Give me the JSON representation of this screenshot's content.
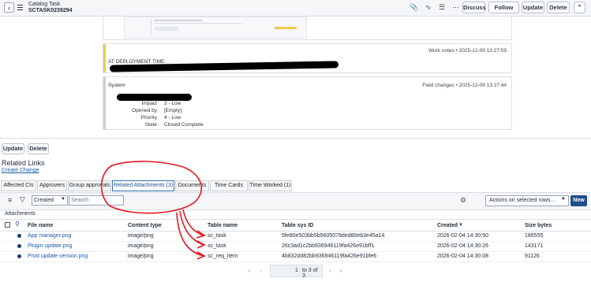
{
  "header": {
    "title": "Catalog Task",
    "number": "SCTASK0239294",
    "buttons": {
      "discuss": "Discuss",
      "follow": "Follow",
      "update": "Update",
      "delete": "Delete"
    }
  },
  "journal": {
    "work_note": {
      "meta": "Work notes • 2025-12-09 13:27:59",
      "text": "AT DEPLOYMENT TIME:"
    },
    "field_change": {
      "author": "System",
      "meta": "Field changes • 2025-12-09 13:27:44",
      "fields": [
        {
          "label": "Impact",
          "value": "3 - Low"
        },
        {
          "label": "Opened by",
          "value": "[Empty]"
        },
        {
          "label": "Priority",
          "value": "4 - Low"
        },
        {
          "label": "State",
          "value": "Closed Complete"
        }
      ]
    }
  },
  "form_actions": {
    "update": "Update",
    "delete": "Delete"
  },
  "related": {
    "heading": "Related Links",
    "create_change": "Create Change",
    "tabs": [
      {
        "label": "Affected CIs"
      },
      {
        "label": "Approvers"
      },
      {
        "label": "Group approvals"
      },
      {
        "label": "Related Attachments (3)"
      },
      {
        "label": "Documents"
      },
      {
        "label": "Time Cards (1)"
      },
      {
        "label": "Time Worked (1)"
      }
    ]
  },
  "list": {
    "filter_field": "Created",
    "search_placeholder": "Search",
    "actions_label": "Actions on selected rows...",
    "new_label": "New",
    "breadcrumb": "Attachments",
    "columns": [
      "File name",
      "Content type",
      "Table name",
      "Table sys ID",
      "Created",
      "Size bytes"
    ],
    "rows": [
      {
        "file": "App manager.png",
        "type": "image/png",
        "table": "sc_task",
        "sysid": "5fe80e503bb5b5605078ded80eb3e45a14",
        "created": "2026-02-04 14:30:50",
        "size": "186555"
      },
      {
        "file": "Plugin update.png",
        "type": "image/png",
        "table": "sc_task",
        "sysid": "26c3ad1c2bb936946119fa426e91bff1",
        "created": "2026-02-04 14:30:26",
        "size": "143171"
      },
      {
        "file": "Prod update version.png",
        "type": "image/png",
        "table": "sc_req_item",
        "sysid": "4b832dd82bb936946119fa426e91bfe6",
        "created": "2026-02-04 14:30:08",
        "size": "91126"
      }
    ],
    "pagination": {
      "current": "1",
      "summary": "to 3 of 3"
    }
  },
  "colors": {
    "accent": "#1a5aa8",
    "annotation": "#e8141e",
    "header_bg": "#f4f6f8"
  }
}
